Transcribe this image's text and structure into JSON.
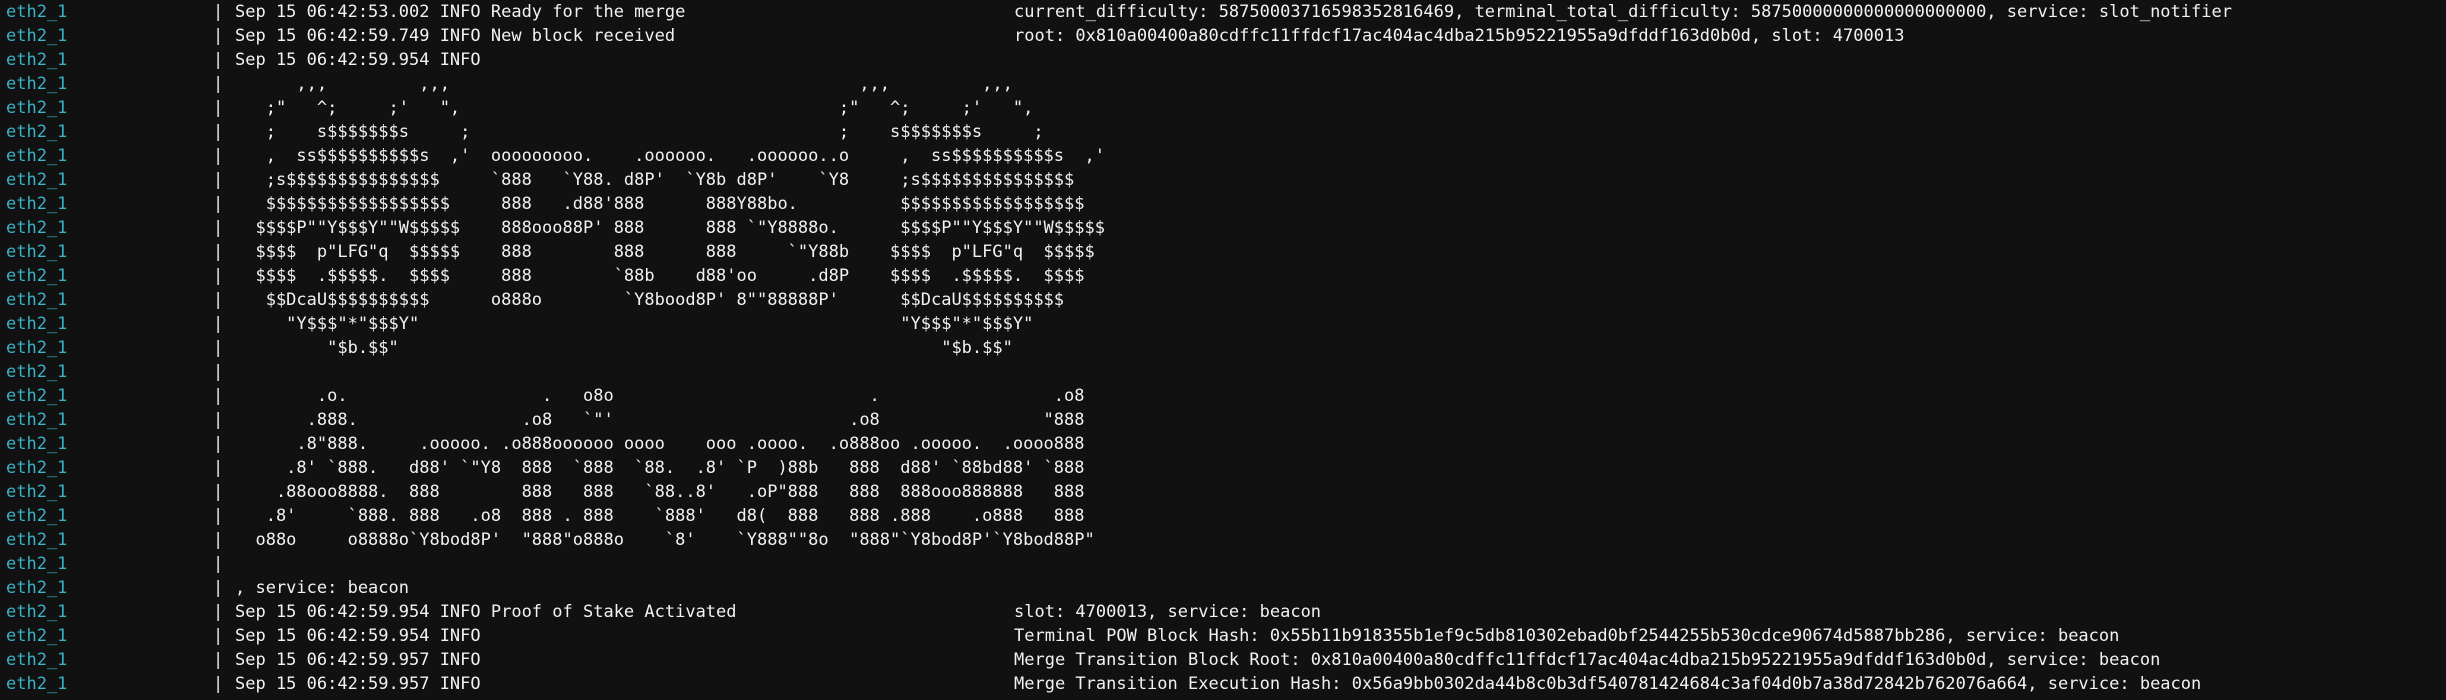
{
  "colors": {
    "background": "#111111",
    "prefix": "#36b4c5",
    "text": "#f2f2f2"
  },
  "lines": [
    {
      "prefix": "eth2_1",
      "sep": "|",
      "msg": "Sep 15 06:42:53.002 INFO Ready for the merge",
      "extra": "current_difficulty: 58750003716598352816469, terminal_total_difficulty: 58750000000000000000000, service: slot_notifier"
    },
    {
      "prefix": "eth2_1",
      "sep": "|",
      "msg": "Sep 15 06:42:59.749 INFO New block received",
      "extra": "root: 0x810a00400a80cdffc11ffdcf17ac404ac4dba215b95221955a9dfddf163d0b0d, slot: 4700013"
    },
    {
      "prefix": "eth2_1",
      "sep": "|",
      "msg": "Sep 15 06:42:59.954 INFO",
      "extra": ""
    },
    {
      "prefix": "eth2_1",
      "sep": "|",
      "msg": "      ,,,         ,,,                                        ,,,         ,,,",
      "extra": ""
    },
    {
      "prefix": "eth2_1",
      "sep": "|",
      "msg": "   ;\"   ^;     ;'   \",                                     ;\"   ^;     ;'   \",",
      "extra": ""
    },
    {
      "prefix": "eth2_1",
      "sep": "|",
      "msg": "   ;    s$$$$$$$s     ;                                    ;    s$$$$$$$s     ;",
      "extra": ""
    },
    {
      "prefix": "eth2_1",
      "sep": "|",
      "msg": "   ,  ss$$$$$$$$$$s  ,'  ooooooooo.    .oooooo.   .oooooo..o     ,  ss$$$$$$$$$$s  ,'",
      "extra": ""
    },
    {
      "prefix": "eth2_1",
      "sep": "|",
      "msg": "   ;s$$$$$$$$$$$$$$$     `888   `Y88. d8P'  `Y8b d8P'    `Y8     ;s$$$$$$$$$$$$$$$",
      "extra": ""
    },
    {
      "prefix": "eth2_1",
      "sep": "|",
      "msg": "   $$$$$$$$$$$$$$$$$$     888   .d88'888      888Y88bo.          $$$$$$$$$$$$$$$$$$",
      "extra": ""
    },
    {
      "prefix": "eth2_1",
      "sep": "|",
      "msg": "  $$$$P\"\"Y$$$Y\"\"W$$$$$    888ooo88P' 888      888 `\"Y8888o.      $$$$P\"\"Y$$$Y\"\"W$$$$$",
      "extra": ""
    },
    {
      "prefix": "eth2_1",
      "sep": "|",
      "msg": "  $$$$  p\"LFG\"q  $$$$$    888        888      888     `\"Y88b    $$$$  p\"LFG\"q  $$$$$",
      "extra": ""
    },
    {
      "prefix": "eth2_1",
      "sep": "|",
      "msg": "  $$$$  .$$$$$.  $$$$     888        `88b    d88'oo     .d8P    $$$$  .$$$$$.  $$$$",
      "extra": ""
    },
    {
      "prefix": "eth2_1",
      "sep": "|",
      "msg": "   $$DcaU$$$$$$$$$$      o888o        `Y8bood8P' 8\"\"88888P'      $$DcaU$$$$$$$$$$",
      "extra": ""
    },
    {
      "prefix": "eth2_1",
      "sep": "|",
      "msg": "     \"Y$$$\"*\"$$$Y\"                                               \"Y$$$\"*\"$$$Y\"",
      "extra": ""
    },
    {
      "prefix": "eth2_1",
      "sep": "|",
      "msg": "         \"$b.$$\"                                                     \"$b.$$\"",
      "extra": ""
    },
    {
      "prefix": "eth2_1",
      "sep": "|",
      "msg": "",
      "extra": ""
    },
    {
      "prefix": "eth2_1",
      "sep": "|",
      "msg": "        .o.                   .   o8o                         .                 .o8",
      "extra": ""
    },
    {
      "prefix": "eth2_1",
      "sep": "|",
      "msg": "       .888.                .o8   `\"'                       .o8                \"888",
      "extra": ""
    },
    {
      "prefix": "eth2_1",
      "sep": "|",
      "msg": "      .8\"888.     .ooooo. .o888oooooo oooo    ooo .oooo.  .o888oo .ooooo.  .oooo888",
      "extra": ""
    },
    {
      "prefix": "eth2_1",
      "sep": "|",
      "msg": "     .8' `888.   d88' `\"Y8  888  `888  `88.  .8' `P  )88b   888  d88' `88bd88' `888",
      "extra": ""
    },
    {
      "prefix": "eth2_1",
      "sep": "|",
      "msg": "    .88ooo8888.  888        888   888   `88..8'   .oP\"888   888  888ooo888888   888",
      "extra": ""
    },
    {
      "prefix": "eth2_1",
      "sep": "|",
      "msg": "   .8'     `888. 888   .o8  888 . 888    `888'   d8(  888   888 .888    .o888   888",
      "extra": ""
    },
    {
      "prefix": "eth2_1",
      "sep": "|",
      "msg": "  o88o     o8888o`Y8bod8P'  \"888\"o888o    `8'    `Y888\"\"8o  \"888\"`Y8bod8P'`Y8bod88P\"",
      "extra": ""
    },
    {
      "prefix": "eth2_1",
      "sep": "|",
      "msg": "",
      "extra": ""
    },
    {
      "prefix": "eth2_1",
      "sep": "|",
      "msg": ", service: beacon",
      "extra": ""
    },
    {
      "prefix": "eth2_1",
      "sep": "|",
      "msg": "Sep 15 06:42:59.954 INFO Proof of Stake Activated",
      "extra": "slot: 4700013, service: beacon"
    },
    {
      "prefix": "eth2_1",
      "sep": "|",
      "msg": "Sep 15 06:42:59.954 INFO",
      "extra": "Terminal POW Block Hash: 0x55b11b918355b1ef9c5db810302ebad0bf2544255b530cdce90674d5887bb286, service: beacon"
    },
    {
      "prefix": "eth2_1",
      "sep": "|",
      "msg": "Sep 15 06:42:59.957 INFO",
      "extra": "Merge Transition Block Root: 0x810a00400a80cdffc11ffdcf17ac404ac4dba215b95221955a9dfddf163d0b0d, service: beacon"
    },
    {
      "prefix": "eth2_1",
      "sep": "|",
      "msg": "Sep 15 06:42:59.957 INFO",
      "extra": "Merge Transition Execution Hash: 0x56a9bb0302da44b8c0b3df540781424684c3af04d0b7a38d72842b762076a664, service: beacon"
    }
  ]
}
